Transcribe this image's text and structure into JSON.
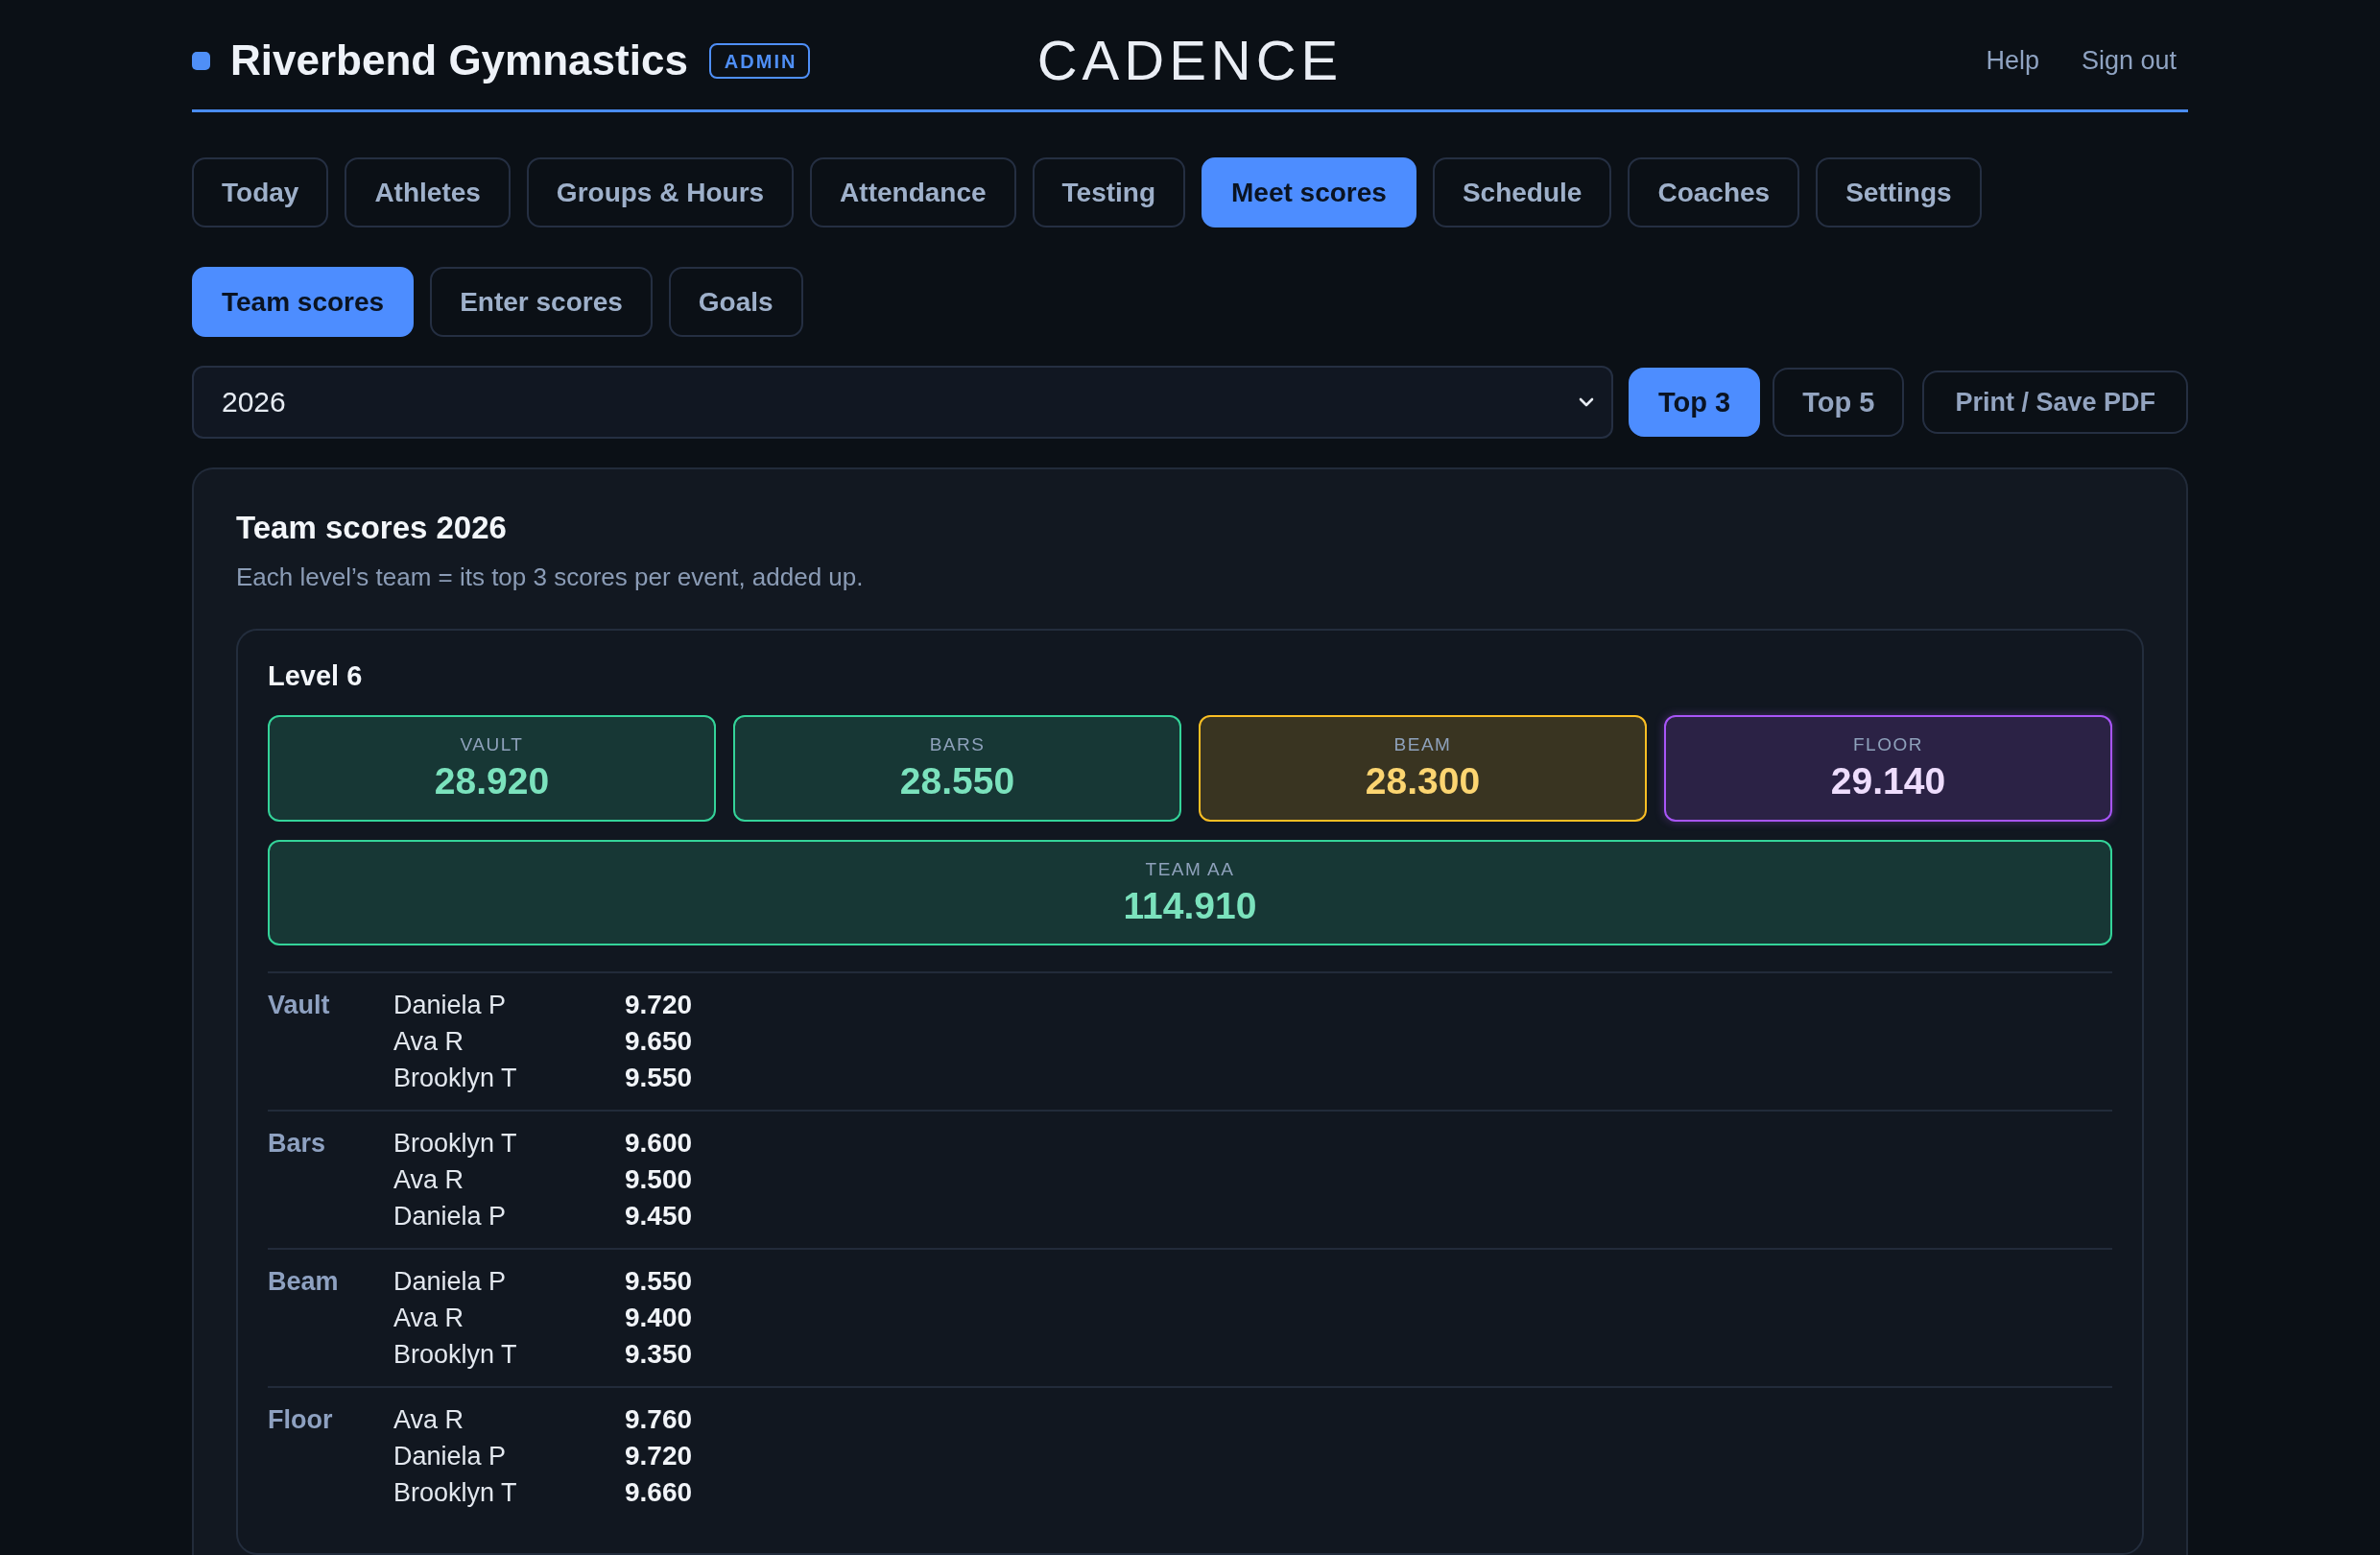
{
  "header": {
    "brand": "Riverbend Gymnastics",
    "role_badge": "ADMIN",
    "logo": "CADENCE",
    "links": [
      "Help",
      "Sign out"
    ]
  },
  "nav_tabs": [
    {
      "label": "Today",
      "selected": false
    },
    {
      "label": "Athletes",
      "selected": false
    },
    {
      "label": "Groups & Hours",
      "selected": false
    },
    {
      "label": "Attendance",
      "selected": false
    },
    {
      "label": "Testing",
      "selected": false
    },
    {
      "label": "Meet scores",
      "selected": true
    },
    {
      "label": "Schedule",
      "selected": false
    },
    {
      "label": "Coaches",
      "selected": false
    },
    {
      "label": "Settings",
      "selected": false
    }
  ],
  "sub_tabs": [
    {
      "label": "Team scores",
      "selected": true
    },
    {
      "label": "Enter scores",
      "selected": false
    },
    {
      "label": "Goals",
      "selected": false
    }
  ],
  "filters": {
    "year": "2026",
    "view_options": [
      {
        "label": "Top 3",
        "selected": true
      },
      {
        "label": "Top 5",
        "selected": false
      }
    ],
    "print_button": "Print / Save PDF"
  },
  "report": {
    "title": "Team scores 2026",
    "subtitle": "Each level’s team = its top 3 scores per event, added up.",
    "levels": [
      {
        "title": "Level 6",
        "tiles": [
          {
            "kind": "event",
            "label": "VAULT",
            "value": "28.920",
            "color": "#34d399",
            "highlighted": false
          },
          {
            "kind": "event",
            "label": "BARS",
            "value": "28.550",
            "color": "#34d399",
            "highlighted": false
          },
          {
            "kind": "event",
            "label": "BEAM",
            "value": "28.300",
            "color": "#fbbf24",
            "highlighted": false
          },
          {
            "kind": "event",
            "label": "FLOOR",
            "value": "29.140",
            "color": "#a855f7",
            "highlighted": true
          },
          {
            "kind": "total",
            "label": "TEAM AA",
            "value": "114.910",
            "color": "#34d399",
            "highlighted": false
          }
        ],
        "events": [
          {
            "name": "Vault",
            "scores": [
              {
                "athlete": "Daniela P",
                "score": "9.720"
              },
              {
                "athlete": "Ava R",
                "score": "9.650"
              },
              {
                "athlete": "Brooklyn T",
                "score": "9.550"
              }
            ]
          },
          {
            "name": "Bars",
            "scores": [
              {
                "athlete": "Brooklyn T",
                "score": "9.600"
              },
              {
                "athlete": "Ava R",
                "score": "9.500"
              },
              {
                "athlete": "Daniela P",
                "score": "9.450"
              }
            ]
          },
          {
            "name": "Beam",
            "scores": [
              {
                "athlete": "Daniela P",
                "score": "9.550"
              },
              {
                "athlete": "Ava R",
                "score": "9.400"
              },
              {
                "athlete": "Brooklyn T",
                "score": "9.350"
              }
            ]
          },
          {
            "name": "Floor",
            "scores": [
              {
                "athlete": "Ava R",
                "score": "9.760"
              },
              {
                "athlete": "Daniela P",
                "score": "9.720"
              },
              {
                "athlete": "Brooklyn T",
                "score": "9.660"
              }
            ]
          }
        ]
      }
    ]
  }
}
